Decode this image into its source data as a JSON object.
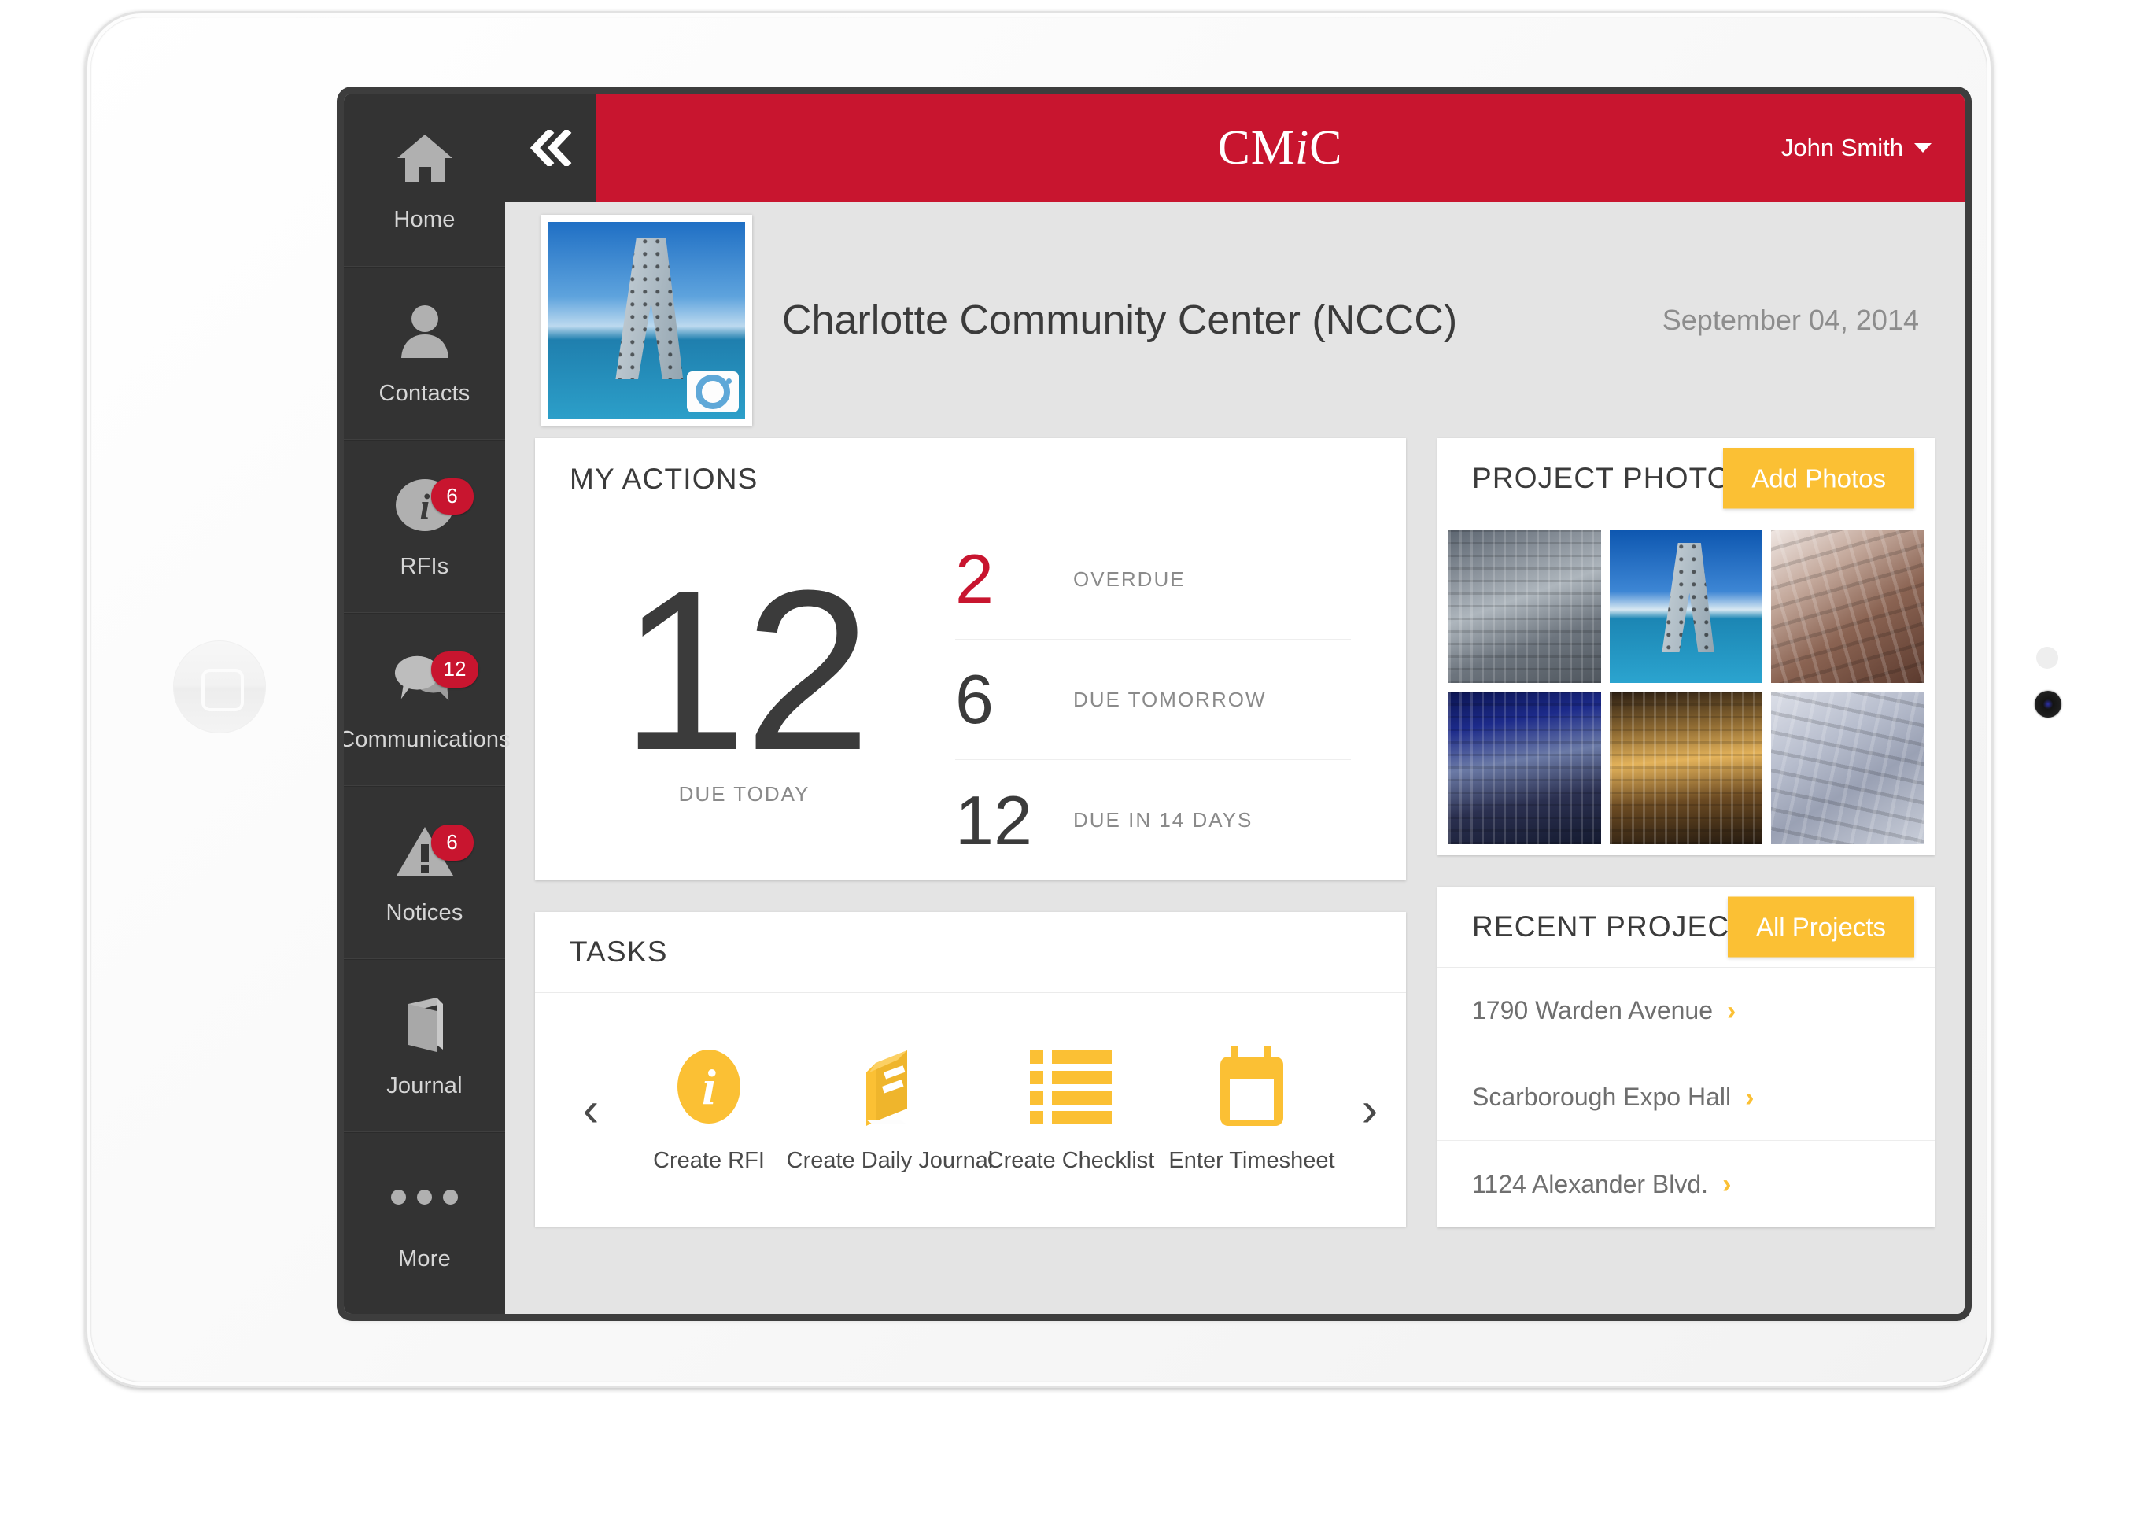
{
  "brand": {
    "logo_text": "CM",
    "logo_italic": "i",
    "logo_text_end": "C",
    "accent_red": "#C8152F",
    "accent_yellow": "#FBC034",
    "sidebar_dark": "#333333"
  },
  "topbar": {
    "collapse_icon": "double-chevron-left-icon",
    "user_name": "John Smith",
    "user_caret": "caret-down-icon"
  },
  "sidebar": {
    "items": [
      {
        "label": "Home",
        "icon": "home-icon",
        "badge": null
      },
      {
        "label": "Contacts",
        "icon": "person-icon",
        "badge": null
      },
      {
        "label": "RFIs",
        "icon": "info-circle-icon",
        "badge": "6"
      },
      {
        "label": "Communications",
        "icon": "chat-bubbles-icon",
        "badge": "12"
      },
      {
        "label": "Notices",
        "icon": "warning-triangle-icon",
        "badge": "6"
      },
      {
        "label": "Journal",
        "icon": "book-icon",
        "badge": null
      },
      {
        "label": "More",
        "icon": "ellipsis-icon",
        "badge": null
      }
    ]
  },
  "project_header": {
    "title": "Charlotte Community Center (NCCC)",
    "date": "September 04, 2014",
    "thumbnail_alt": "project-photo-thumbnail",
    "camera_icon": "camera-icon"
  },
  "my_actions": {
    "title": "MY ACTIONS",
    "primary_value": "12",
    "primary_label": "DUE TODAY",
    "rows": [
      {
        "value": "2",
        "label": "OVERDUE",
        "color": "#C8152F"
      },
      {
        "value": "6",
        "label": "DUE TOMORROW",
        "color": "#3B3B3B"
      },
      {
        "value": "12",
        "label": "DUE IN 14 DAYS",
        "color": "#3B3B3B"
      }
    ]
  },
  "tasks": {
    "title": "TASKS",
    "prev_icon": "chevron-left-icon",
    "next_icon": "chevron-right-icon",
    "items": [
      {
        "label": "Create RFI",
        "icon": "info-circle-icon"
      },
      {
        "label": "Create Daily Journal",
        "icon": "book-icon"
      },
      {
        "label": "Create Checklist",
        "icon": "checklist-icon"
      },
      {
        "label": "Enter Timesheet",
        "icon": "calendar-icon"
      }
    ]
  },
  "project_photos": {
    "title": "PROJECT PHOTOS",
    "button_label": "Add Photos",
    "photos": [
      {
        "alt": "glass-office-tower-photo"
      },
      {
        "alt": "perforated-arch-tower-photo"
      },
      {
        "alt": "sepia-highrise-upward-photo"
      },
      {
        "alt": "night-skyline-blue-photo"
      },
      {
        "alt": "illuminated-clock-tower-photo"
      },
      {
        "alt": "pale-apartment-block-photo"
      }
    ]
  },
  "recent_projects": {
    "title": "RECENT PROJECTS",
    "button_label": "All Projects",
    "items": [
      {
        "name": "1790 Warden Avenue",
        "chevron": "›"
      },
      {
        "name": "Scarborough Expo Hall",
        "chevron": "›"
      },
      {
        "name": "1124 Alexander Blvd.",
        "chevron": "›"
      }
    ]
  }
}
